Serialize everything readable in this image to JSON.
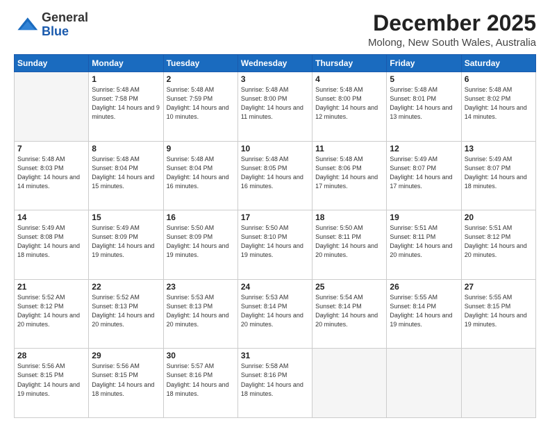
{
  "header": {
    "logo_general": "General",
    "logo_blue": "Blue",
    "month_title": "December 2025",
    "location": "Molong, New South Wales, Australia"
  },
  "days_of_week": [
    "Sunday",
    "Monday",
    "Tuesday",
    "Wednesday",
    "Thursday",
    "Friday",
    "Saturday"
  ],
  "weeks": [
    [
      {
        "day": "",
        "empty": true
      },
      {
        "day": "1",
        "sunrise": "5:48 AM",
        "sunset": "7:58 PM",
        "daylight": "14 hours and 9 minutes."
      },
      {
        "day": "2",
        "sunrise": "5:48 AM",
        "sunset": "7:59 PM",
        "daylight": "14 hours and 10 minutes."
      },
      {
        "day": "3",
        "sunrise": "5:48 AM",
        "sunset": "8:00 PM",
        "daylight": "14 hours and 11 minutes."
      },
      {
        "day": "4",
        "sunrise": "5:48 AM",
        "sunset": "8:00 PM",
        "daylight": "14 hours and 12 minutes."
      },
      {
        "day": "5",
        "sunrise": "5:48 AM",
        "sunset": "8:01 PM",
        "daylight": "14 hours and 13 minutes."
      },
      {
        "day": "6",
        "sunrise": "5:48 AM",
        "sunset": "8:02 PM",
        "daylight": "14 hours and 14 minutes."
      }
    ],
    [
      {
        "day": "7",
        "sunrise": "5:48 AM",
        "sunset": "8:03 PM",
        "daylight": "14 hours and 14 minutes."
      },
      {
        "day": "8",
        "sunrise": "5:48 AM",
        "sunset": "8:04 PM",
        "daylight": "14 hours and 15 minutes."
      },
      {
        "day": "9",
        "sunrise": "5:48 AM",
        "sunset": "8:04 PM",
        "daylight": "14 hours and 16 minutes."
      },
      {
        "day": "10",
        "sunrise": "5:48 AM",
        "sunset": "8:05 PM",
        "daylight": "14 hours and 16 minutes."
      },
      {
        "day": "11",
        "sunrise": "5:48 AM",
        "sunset": "8:06 PM",
        "daylight": "14 hours and 17 minutes."
      },
      {
        "day": "12",
        "sunrise": "5:49 AM",
        "sunset": "8:07 PM",
        "daylight": "14 hours and 17 minutes."
      },
      {
        "day": "13",
        "sunrise": "5:49 AM",
        "sunset": "8:07 PM",
        "daylight": "14 hours and 18 minutes."
      }
    ],
    [
      {
        "day": "14",
        "sunrise": "5:49 AM",
        "sunset": "8:08 PM",
        "daylight": "14 hours and 18 minutes."
      },
      {
        "day": "15",
        "sunrise": "5:49 AM",
        "sunset": "8:09 PM",
        "daylight": "14 hours and 19 minutes."
      },
      {
        "day": "16",
        "sunrise": "5:50 AM",
        "sunset": "8:09 PM",
        "daylight": "14 hours and 19 minutes."
      },
      {
        "day": "17",
        "sunrise": "5:50 AM",
        "sunset": "8:10 PM",
        "daylight": "14 hours and 19 minutes."
      },
      {
        "day": "18",
        "sunrise": "5:50 AM",
        "sunset": "8:11 PM",
        "daylight": "14 hours and 20 minutes."
      },
      {
        "day": "19",
        "sunrise": "5:51 AM",
        "sunset": "8:11 PM",
        "daylight": "14 hours and 20 minutes."
      },
      {
        "day": "20",
        "sunrise": "5:51 AM",
        "sunset": "8:12 PM",
        "daylight": "14 hours and 20 minutes."
      }
    ],
    [
      {
        "day": "21",
        "sunrise": "5:52 AM",
        "sunset": "8:12 PM",
        "daylight": "14 hours and 20 minutes."
      },
      {
        "day": "22",
        "sunrise": "5:52 AM",
        "sunset": "8:13 PM",
        "daylight": "14 hours and 20 minutes."
      },
      {
        "day": "23",
        "sunrise": "5:53 AM",
        "sunset": "8:13 PM",
        "daylight": "14 hours and 20 minutes."
      },
      {
        "day": "24",
        "sunrise": "5:53 AM",
        "sunset": "8:14 PM",
        "daylight": "14 hours and 20 minutes."
      },
      {
        "day": "25",
        "sunrise": "5:54 AM",
        "sunset": "8:14 PM",
        "daylight": "14 hours and 20 minutes."
      },
      {
        "day": "26",
        "sunrise": "5:55 AM",
        "sunset": "8:14 PM",
        "daylight": "14 hours and 19 minutes."
      },
      {
        "day": "27",
        "sunrise": "5:55 AM",
        "sunset": "8:15 PM",
        "daylight": "14 hours and 19 minutes."
      }
    ],
    [
      {
        "day": "28",
        "sunrise": "5:56 AM",
        "sunset": "8:15 PM",
        "daylight": "14 hours and 19 minutes."
      },
      {
        "day": "29",
        "sunrise": "5:56 AM",
        "sunset": "8:15 PM",
        "daylight": "14 hours and 18 minutes."
      },
      {
        "day": "30",
        "sunrise": "5:57 AM",
        "sunset": "8:16 PM",
        "daylight": "14 hours and 18 minutes."
      },
      {
        "day": "31",
        "sunrise": "5:58 AM",
        "sunset": "8:16 PM",
        "daylight": "14 hours and 18 minutes."
      },
      {
        "day": "",
        "empty": true
      },
      {
        "day": "",
        "empty": true
      },
      {
        "day": "",
        "empty": true
      }
    ]
  ],
  "labels": {
    "sunrise_prefix": "Sunrise: ",
    "sunset_prefix": "Sunset: ",
    "daylight_prefix": "Daylight: "
  }
}
